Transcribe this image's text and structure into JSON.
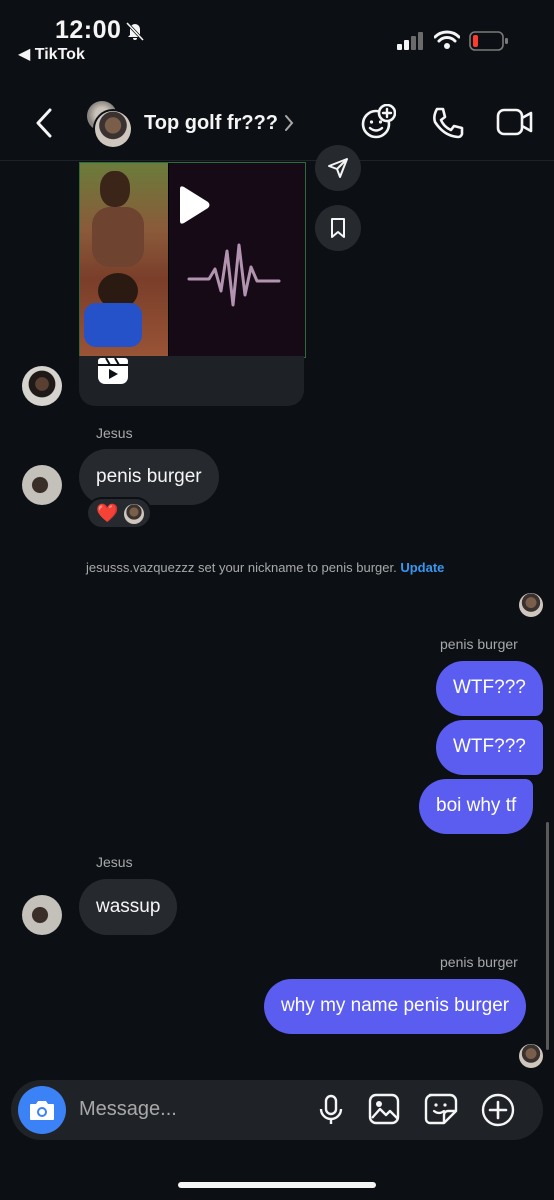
{
  "status_bar": {
    "time": "12:00",
    "back_app": "◀ TikTok"
  },
  "header": {
    "title": "Top golf fr???",
    "chevron": "›"
  },
  "icons": {
    "back": "chevron-left-icon",
    "effects": "face-effect-icon",
    "call": "phone-icon",
    "video": "video-camera-icon",
    "share": "paper-plane-icon",
    "save": "bookmark-icon",
    "reel": "reels-icon",
    "camera": "camera-icon",
    "mic": "microphone-icon",
    "gallery": "image-icon",
    "sticker": "sticker-icon",
    "add": "plus-icon"
  },
  "messages": {
    "sender_jesus_1": "Jesus",
    "msg1": "penis burger",
    "reaction": "❤️",
    "system_text": "jesusss.vazquezzz set your nickname to penis burger.",
    "system_link": "Update",
    "sender_me_1": "penis burger",
    "out1": "WTF???",
    "out2": "WTF???",
    "out3": "boi why tf",
    "sender_jesus_2": "Jesus",
    "msg2": "wassup",
    "sender_me_2": "penis burger",
    "out4": "why my name penis burger"
  },
  "composer": {
    "placeholder": "Message..."
  },
  "colors": {
    "background": "#0c1014",
    "outgoing_bubble": "#5b5cf0",
    "incoming_bubble": "#262a2f",
    "link": "#3897f0",
    "camera_button": "#3b82f6"
  }
}
